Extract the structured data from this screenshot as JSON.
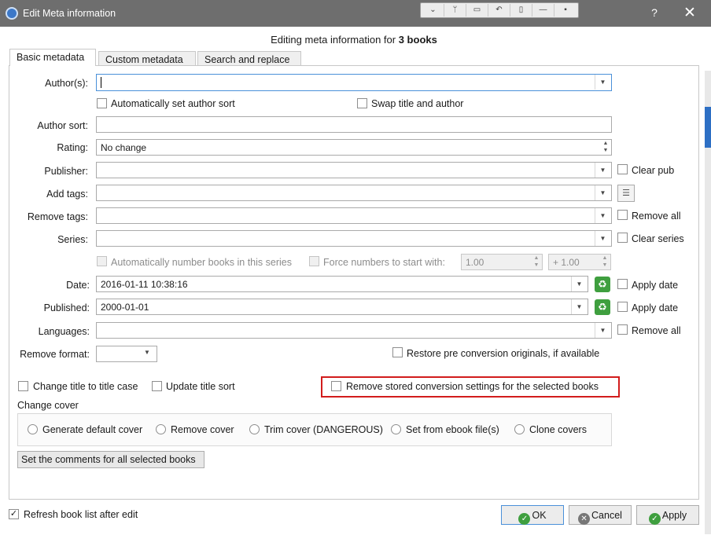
{
  "window": {
    "title": "Edit Meta information",
    "help": "?",
    "close": "✕"
  },
  "toolbar": {
    "icons": [
      "⌄",
      "ᛘ",
      "▭",
      "↶",
      "▯",
      "—",
      "▪"
    ]
  },
  "header": {
    "prefix": "Editing meta information for ",
    "count": "3 books"
  },
  "tabs": [
    "Basic metadata",
    "Custom metadata",
    "Search and replace"
  ],
  "fields": {
    "authors": {
      "label": "Author(s):",
      "value": ""
    },
    "auto_author_sort": "Automatically set author sort",
    "swap_title_author": "Swap title and author",
    "author_sort": {
      "label": "Author sort:",
      "value": ""
    },
    "rating": {
      "label": "Rating:",
      "value": "No change"
    },
    "publisher": {
      "label": "Publisher:",
      "value": "",
      "side": "Clear pub"
    },
    "add_tags": {
      "label": "Add tags:",
      "value": ""
    },
    "remove_tags": {
      "label": "Remove tags:",
      "value": "",
      "side": "Remove all"
    },
    "series": {
      "label": "Series:",
      "value": "",
      "side": "Clear series"
    },
    "auto_number": "Automatically number books in this series",
    "force_numbers": "Force numbers to start with:",
    "force_start": "1.00",
    "force_increment": "+ 1.00",
    "date": {
      "label": "Date:",
      "value": "2016-01-11 10:38:16",
      "side": "Apply date"
    },
    "published": {
      "label": "Published:",
      "value": "2000-01-01",
      "side": "Apply date"
    },
    "languages": {
      "label": "Languages:",
      "value": "",
      "side": "Remove all"
    },
    "remove_format": {
      "label": "Remove format:",
      "value": ""
    },
    "restore_pre": "Restore pre conversion originals, if available"
  },
  "options": {
    "change_title_case": "Change title to title case",
    "update_title_sort": "Update title sort",
    "remove_conversion": "Remove stored conversion settings for the selected books"
  },
  "cover": {
    "label": "Change cover",
    "radios": [
      "Generate default cover",
      "Remove cover",
      "Trim cover (DANGEROUS)",
      "Set from ebook file(s)",
      "Clone covers"
    ]
  },
  "comments_button": "Set the comments for all selected books",
  "footer": {
    "refresh": "Refresh book list after edit",
    "refresh_checked": true,
    "ok": "OK",
    "cancel": "Cancel",
    "apply": "Apply"
  },
  "colors": {
    "titlebar": "#6e6e6e",
    "highlight": "#d21c1c",
    "ok_green": "#3f9f3f",
    "cancel_grey": "#777777"
  }
}
